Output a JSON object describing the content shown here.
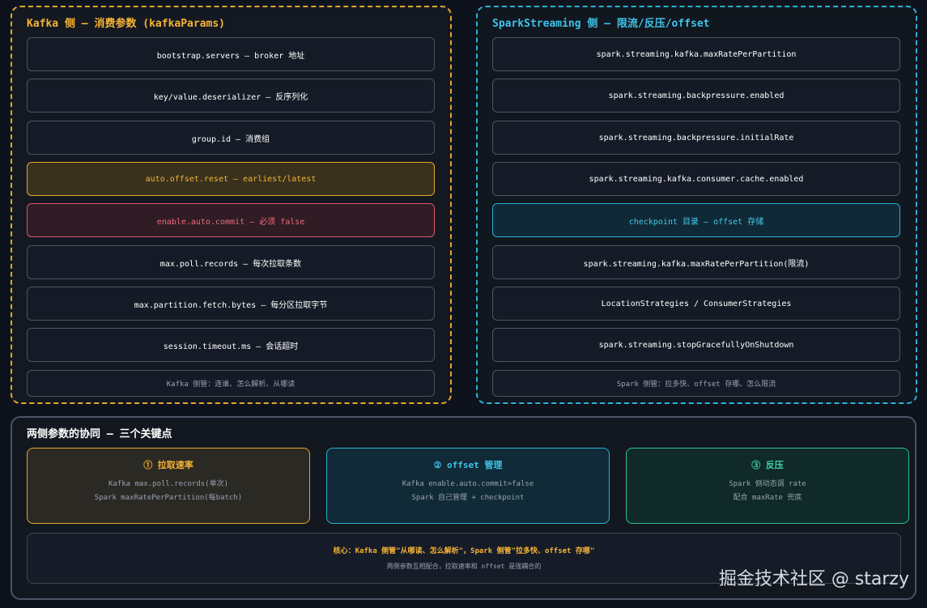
{
  "kafka": {
    "title": "Kafka 侧 — 消费参数 (kafkaParams)",
    "items": [
      "bootstrap.servers — broker 地址",
      "key/value.deserializer — 反序列化",
      "group.id — 消费组",
      "auto.offset.reset — earliest/latest",
      "enable.auto.commit — 必须 false",
      "max.poll.records — 每次拉取条数",
      "max.partition.fetch.bytes — 每分区拉取字节",
      "session.timeout.ms — 会话超时"
    ],
    "note": "Kafka 侧管：连谁、怎么解析、从哪读"
  },
  "spark": {
    "title": "SparkStreaming 侧 — 限流/反压/offset",
    "items": [
      "spark.streaming.kafka.maxRatePerPartition",
      "spark.streaming.backpressure.enabled",
      "spark.streaming.backpressure.initialRate",
      "spark.streaming.kafka.consumer.cache.enabled",
      "checkpoint 目录 — offset 存储",
      "spark.streaming.kafka.maxRatePerPartition(限流)",
      "LocationStrategies / ConsumerStrategies",
      "spark.streaming.stopGracefullyOnShutdown"
    ],
    "note": "Spark 侧管：拉多快、offset 存哪、怎么限流"
  },
  "sync": {
    "title": "两侧参数的协同 — 三个关键点",
    "cards": [
      {
        "title": "① 拉取速率",
        "lines": [
          "Kafka max.poll.records(单次)",
          "Spark maxRatePerPartition(每batch)"
        ]
      },
      {
        "title": "② offset 管理",
        "lines": [
          "Kafka enable.auto.commit=false",
          "Spark 自己管理 + checkpoint"
        ]
      },
      {
        "title": "③ 反压",
        "lines": [
          "Spark 侧动态调 rate",
          "配合 maxRate 兜底"
        ]
      }
    ],
    "core": {
      "line1": "核心：Kafka 侧管\"从哪读、怎么解析\"，Spark 侧管\"拉多快、offset 存哪\"",
      "line2": "两侧参数互相配合，拉取速率和 offset 是强耦合的"
    }
  },
  "watermark": "掘金技术社区 @ starzy",
  "colors": {
    "kafka": "#e3a82b",
    "spark": "#29b3d6",
    "sync": "#2fbf99",
    "danger": "#e0566b"
  }
}
